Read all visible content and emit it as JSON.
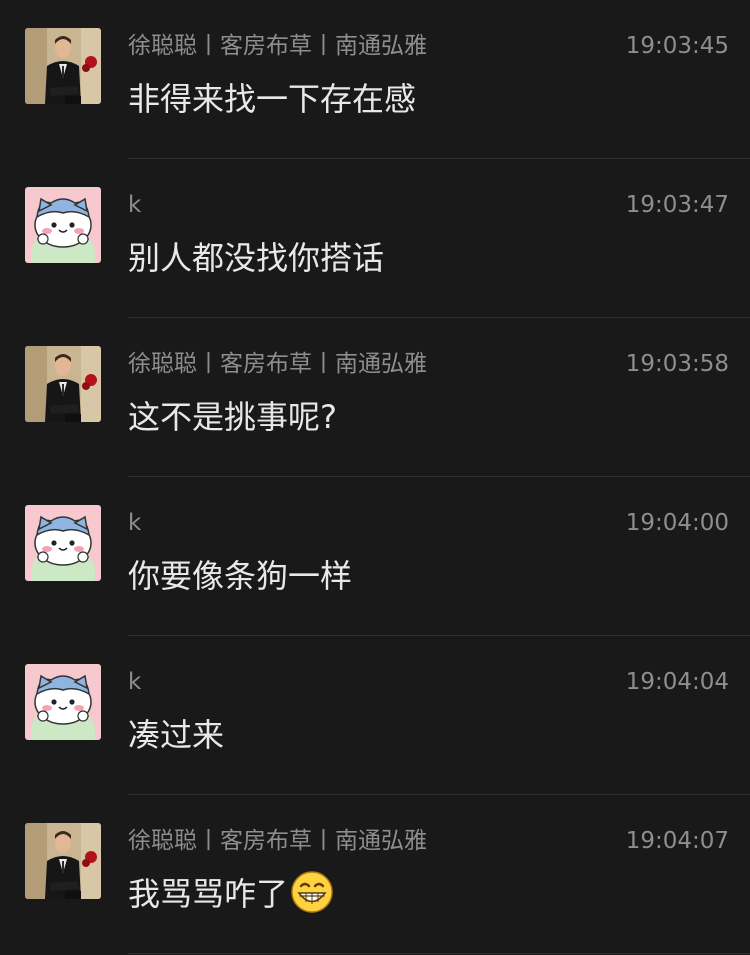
{
  "messages": [
    {
      "sender": "徐聪聪丨客房布草丨南通弘雅",
      "time": "19:03:45",
      "text": "非得来找一下存在感",
      "avatar": "man-in-suit-avatar",
      "emoji": ""
    },
    {
      "sender": "k",
      "time": "19:03:47",
      "text": "别人都没找你搭话",
      "avatar": "cartoon-cat-avatar",
      "emoji": ""
    },
    {
      "sender": "徐聪聪丨客房布草丨南通弘雅",
      "time": "19:03:58",
      "text": "这不是挑事呢?",
      "avatar": "man-in-suit-avatar",
      "emoji": ""
    },
    {
      "sender": "k",
      "time": "19:04:00",
      "text": "你要像条狗一样",
      "avatar": "cartoon-cat-avatar",
      "emoji": ""
    },
    {
      "sender": "k",
      "time": "19:04:04",
      "text": "凑过来",
      "avatar": "cartoon-cat-avatar",
      "emoji": ""
    },
    {
      "sender": "徐聪聪丨客房布草丨南通弘雅",
      "time": "19:04:07",
      "text": "我骂骂咋了",
      "avatar": "man-in-suit-avatar",
      "emoji": "grin-emoji"
    }
  ]
}
